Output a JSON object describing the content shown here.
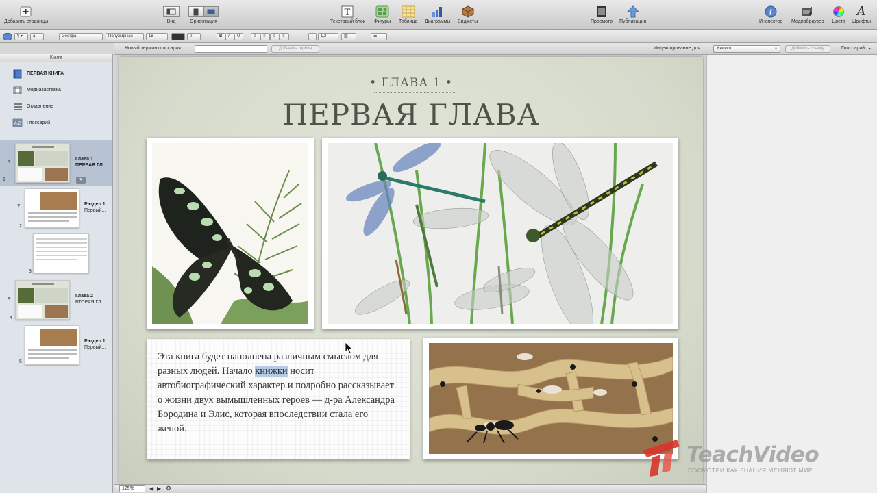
{
  "toolbar": {
    "add_pages": "Добавить страницы",
    "view": "Вид",
    "orientation": "Ориентация",
    "text_block": "Текстовый блок",
    "shapes": "Фигуры",
    "table": "Таблица",
    "charts": "Диаграммы",
    "widgets": "Виджеты",
    "preview": "Просмотр",
    "publish": "Публикация",
    "inspector": "Инспектор",
    "media_browser": "Медиабраузер",
    "colors": "Цвета",
    "fonts": "Шрифты"
  },
  "format": {
    "style": "a",
    "font": "Georgia",
    "weight": "Полужирный",
    "size": "18",
    "stroke": "0",
    "bold": "B",
    "italic": "I",
    "underline": "U",
    "line_spacing": "1,2"
  },
  "glossary": {
    "new_term_label": "Новый термин глоссария:",
    "new_term_value": "",
    "add_term": "Добавить термин",
    "indexing_label": "Индексирование для:",
    "indexing_value": "Книжки",
    "add_link": "Добавить ссылку",
    "glossary": "Глоссарий"
  },
  "sidebar": {
    "header": "Книга",
    "items": [
      {
        "label": "ПЕРВАЯ КНИГА",
        "icon": "book-icon"
      },
      {
        "label": "Медиазаставка",
        "icon": "media-intro-icon"
      },
      {
        "label": "Оглавление",
        "icon": "toc-icon"
      },
      {
        "label": "Глоссарий",
        "icon": "glossary-icon"
      }
    ],
    "thumbs": [
      {
        "num": "1",
        "title": "Глава 1",
        "sub": "ПЕРВАЯ ГЛ..."
      },
      {
        "num": "2",
        "title": "Раздел 1",
        "sub": "Первый..."
      },
      {
        "num": "3",
        "title": "",
        "sub": ""
      },
      {
        "num": "4",
        "title": "Глава 2",
        "sub": "ВТОРАЯ ГЛ..."
      },
      {
        "num": "5",
        "title": "Раздел 1",
        "sub": "Первый..."
      }
    ]
  },
  "page": {
    "chapter_label": "• ГЛАВА 1 •",
    "chapter_title": "ПЕРВАЯ ГЛАВА",
    "body_before": "Эта книга будет наполнена различным смыслом для разных людей. Начало ",
    "body_highlight": "книжки",
    "body_after": " носит автобиографический характер и подробно рассказывает о жизни двух вымышленных героев — д-ра Александра Бородина и Элис, которая впоследствии стала его женой."
  },
  "bottom": {
    "zoom": "125%"
  },
  "watermark": {
    "brand": "TeachVideo",
    "tagline": "ПОСМОТРИ КАК ЗНАНИЯ МЕНЯЮТ МИР"
  },
  "colors": {
    "accent_highlight": "#b4cbe7",
    "page_bg": "#dde1d4",
    "watermark_red": "#d9342b"
  }
}
